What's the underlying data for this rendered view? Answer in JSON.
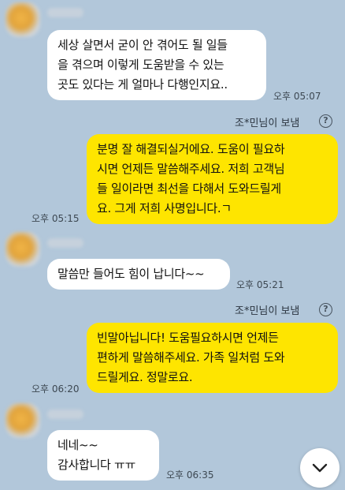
{
  "messages": [
    {
      "lines": [
        "세상 살면서 굳이 안 겪어도 될 일들",
        "을 겪으며 이렇게 도움받을 수 있는",
        "곳도 있다는 게 얼마나 다행인지요.."
      ],
      "time": "오후 05:07"
    },
    {
      "sender_label": "조*민님이 보냄",
      "lines": [
        "분명 잘 해결되실거에요. 도움이 필요하",
        "시면 언제든 말씀해주세요. 저희 고객님",
        "들 일이라면 최선을 다해서 도와드릴게",
        "요. 그게 저희 사명입니다.ㄱ"
      ],
      "time": "오후 05:15"
    },
    {
      "lines": [
        "말씀만 들어도 힘이 납니다~~"
      ],
      "time": "오후 05:21"
    },
    {
      "sender_label": "조*민님이 보냄",
      "lines": [
        "빈말아닙니다! 도움필요하시면 언제든",
        "편하게 말씀해주세요. 가족 일처럼 도와",
        "드릴게요. 정말로요."
      ],
      "time": "오후 06:20"
    },
    {
      "lines": [
        "네네~~",
        "감사합니다 ㅠㅠ"
      ],
      "time": "오후 06:35"
    }
  ],
  "icons": {
    "help": "?",
    "scroll_down": "chevron-down-icon"
  },
  "colors": {
    "background": "#b2c7da",
    "incoming_bubble": "#ffffff",
    "outgoing_bubble": "#fee500"
  }
}
